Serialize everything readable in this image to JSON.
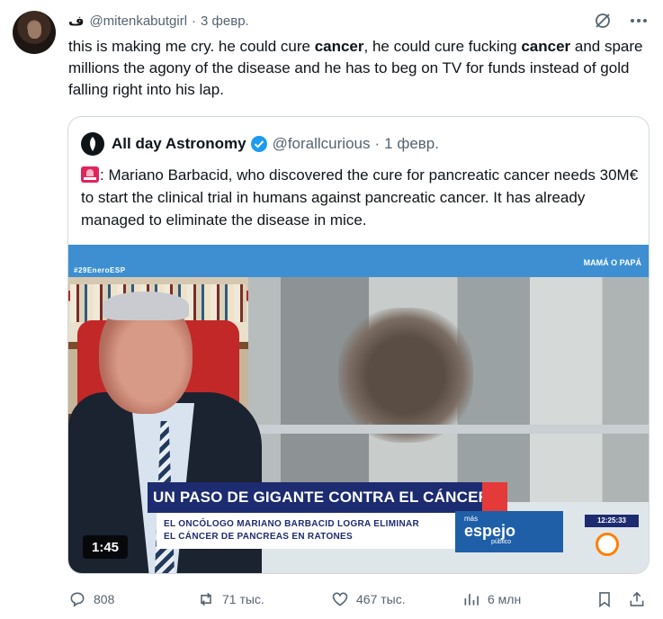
{
  "tweet": {
    "display_name": "ف",
    "handle": "@mitenkabutgirl",
    "date": "3 февр.",
    "text_segments": [
      "this is making me cry. he could cure ",
      "cancer",
      ", he could cure fucking ",
      "cancer",
      " and spare millions the agony of the disease and he has to beg on TV for funds instead of gold falling right into his lap."
    ]
  },
  "quote": {
    "display_name": "All day Astronomy",
    "handle": "@forallcurious",
    "date": "1 февр.",
    "text": ": Mariano Barbacid, who discovered the cure for pancreatic cancer needs 30M€ to start the clinical trial in humans against pancreatic cancer. It has already managed to eliminate the disease in mice.",
    "media": {
      "hashtag": "#29EneroESP",
      "show_logo": "MAMÁ O PAPÁ",
      "headline": "UN PASO DE GIGANTE CONTRA EL CÁNCER",
      "subline_1": "EL ONCÓLOGO MARIANO BARBACID LOGRA ELIMINAR",
      "subline_2": "EL CÁNCER DE PANCREAS EN RATONES",
      "channel_small": "más",
      "channel_big": "espejo",
      "channel_sub": "público",
      "clock": "12:25:33",
      "duration": "1:45"
    }
  },
  "actions": {
    "replies": "808",
    "reposts": "71 тыс.",
    "likes": "467 тыс.",
    "views": "6 млн"
  },
  "colors": {
    "text": "#0f1419",
    "muted": "#536471",
    "border": "#cfd9de",
    "verified": "#1d9bf0"
  }
}
